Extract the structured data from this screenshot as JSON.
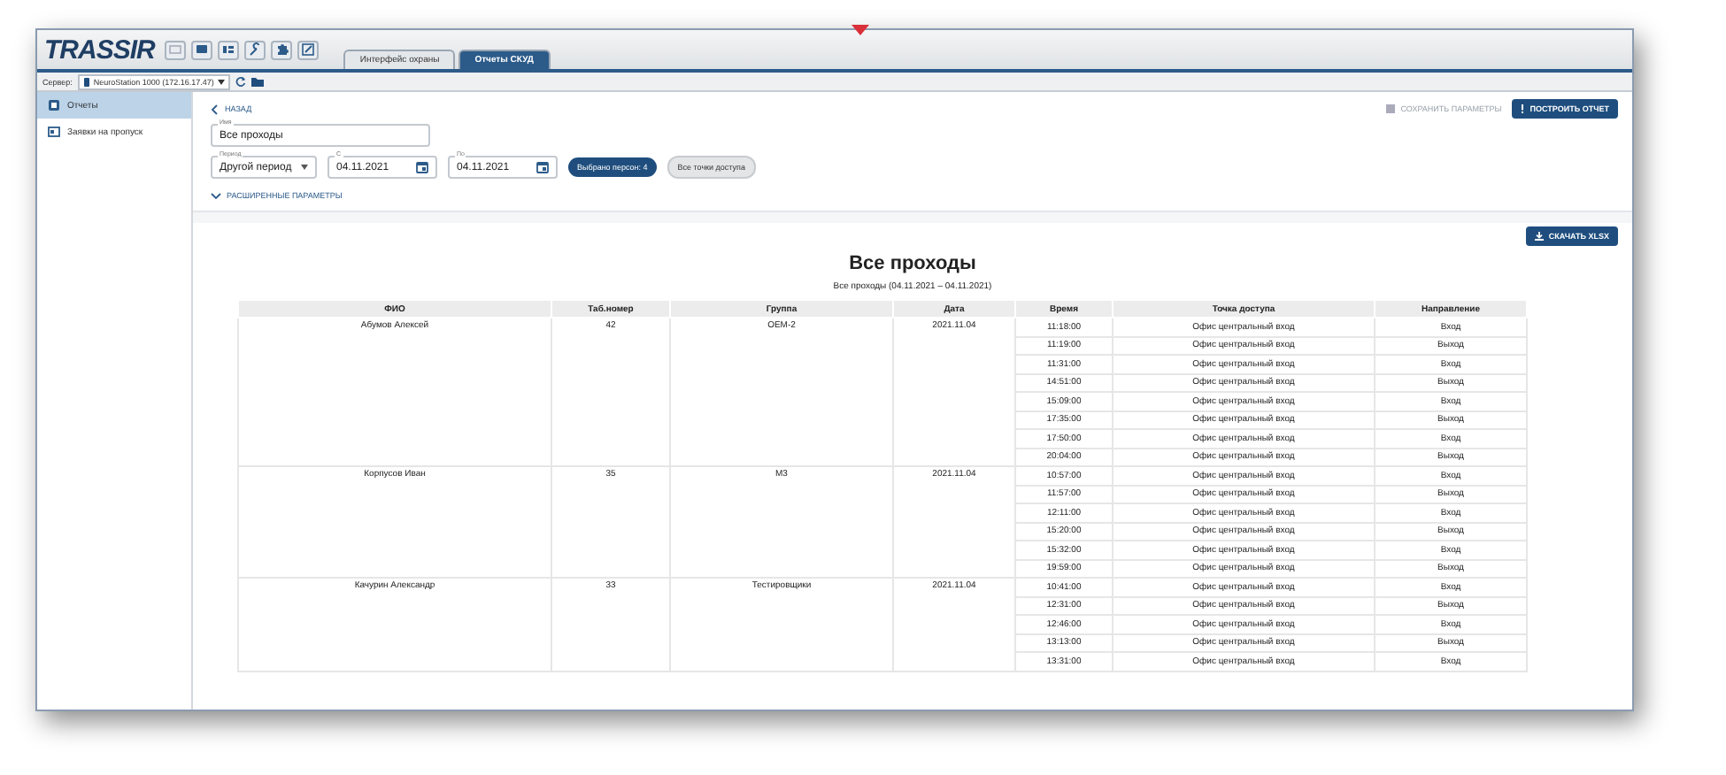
{
  "app_bar": {
    "logo": "TRASSIR",
    "tabs": [
      {
        "label": "Интерфейс охраны",
        "selected": false
      },
      {
        "label": "Отчеты СКУД",
        "selected": true
      }
    ]
  },
  "server_bar": {
    "label": "Сервер:",
    "server": "NeuroStation 1000 (172.16.17.47)"
  },
  "sidebar": {
    "items": [
      {
        "label": "Отчеты",
        "selected": true
      },
      {
        "label": "Заявки на пропуск",
        "selected": false
      }
    ]
  },
  "form": {
    "back": "НАЗАД",
    "save": "СОХРАНИТЬ ПАРАМЕТРЫ",
    "build": "ПОСТРОИТЬ ОТЧЕТ",
    "name": {
      "label": "Имя",
      "value": "Все проходы"
    },
    "period": {
      "label": "Период",
      "value": "Другой период"
    },
    "from": {
      "label": "С",
      "value": "04.11.2021"
    },
    "to": {
      "label": "По",
      "value": "04.11.2021"
    },
    "persons": "Выбрано персон: 4",
    "access_points": "Все точки доступа",
    "advanced": "РАСШИРЕННЫЕ ПАРАМЕТРЫ"
  },
  "report": {
    "download": "СКАЧАТЬ XLSX",
    "title": "Все проходы",
    "subtitle": "Все проходы (04.11.2021 – 04.11.2021)",
    "columns": [
      "ФИО",
      "Таб.номер",
      "Группа",
      "Дата",
      "Время",
      "Точка доступа",
      "Направление"
    ],
    "groups": [
      {
        "name": "Абумов Алексей",
        "tab": "42",
        "group": "ОЕМ-2",
        "date": "2021.11.04",
        "passes": [
          {
            "time": "11:18:00",
            "point": "Офис центральный вход",
            "direction": "Вход"
          },
          {
            "time": "11:19:00",
            "point": "Офис центральный вход",
            "direction": "Выход"
          },
          {
            "time": "11:31:00",
            "point": "Офис центральный вход",
            "direction": "Вход"
          },
          {
            "time": "14:51:00",
            "point": "Офис центральный вход",
            "direction": "Выход"
          },
          {
            "time": "15:09:00",
            "point": "Офис центральный вход",
            "direction": "Вход"
          },
          {
            "time": "17:35:00",
            "point": "Офис центральный вход",
            "direction": "Выход"
          },
          {
            "time": "17:50:00",
            "point": "Офис центральный вход",
            "direction": "Вход"
          },
          {
            "time": "20:04:00",
            "point": "Офис центральный вход",
            "direction": "Выход"
          }
        ]
      },
      {
        "name": "Корпусов Иван",
        "tab": "35",
        "group": "М3",
        "date": "2021.11.04",
        "passes": [
          {
            "time": "10:57:00",
            "point": "Офис центральный вход",
            "direction": "Вход"
          },
          {
            "time": "11:57:00",
            "point": "Офис центральный вход",
            "direction": "Выход"
          },
          {
            "time": "12:11:00",
            "point": "Офис центральный вход",
            "direction": "Вход"
          },
          {
            "time": "15:20:00",
            "point": "Офис центральный вход",
            "direction": "Выход"
          },
          {
            "time": "15:32:00",
            "point": "Офис центральный вход",
            "direction": "Вход"
          },
          {
            "time": "19:59:00",
            "point": "Офис центральный вход",
            "direction": "Выход"
          }
        ]
      },
      {
        "name": "Качурин Александр",
        "tab": "33",
        "group": "Тестировщики",
        "date": "2021.11.04",
        "passes": [
          {
            "time": "10:41:00",
            "point": "Офис центральный вход",
            "direction": "Вход"
          },
          {
            "time": "12:31:00",
            "point": "Офис центральный вход",
            "direction": "Выход"
          },
          {
            "time": "12:46:00",
            "point": "Офис центральный вход",
            "direction": "Вход"
          },
          {
            "time": "13:13:00",
            "point": "Офис центральный вход",
            "direction": "Выход"
          },
          {
            "time": "13:31:00",
            "point": "Офис центральный вход",
            "direction": "Вход"
          }
        ]
      }
    ]
  }
}
